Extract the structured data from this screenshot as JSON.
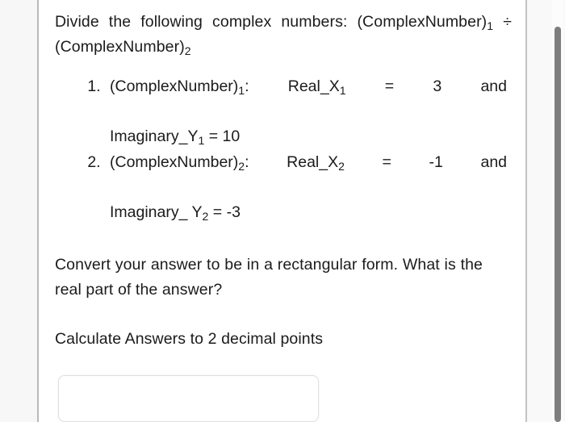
{
  "document": {
    "background_color": "#ffffff",
    "text_color": "#1b1b1b",
    "gutter_color": "#f7f7f7",
    "rule_color": "#b9b9b9"
  },
  "question": {
    "prompt_line_1": "Divide the following complex numbers:",
    "prompt_line_2_prefix": "(ComplexNumber)",
    "prompt_line_2_sub_1": "1",
    "prompt_operator": " ÷ ",
    "prompt_line_2_suffix": "(ComplexNumber)",
    "prompt_line_2_sub_2": "2",
    "items": [
      {
        "marker": "1.",
        "name": "(ComplexNumber)",
        "name_sub": "1",
        "colon": ":",
        "real_label": "Real_X",
        "real_sub": "1",
        "equals": "=",
        "real_value": "3",
        "conjunction": "and",
        "imag_label": "Imaginary_Y",
        "imag_sub": "1",
        "imag_equals": "=",
        "imag_value": "10"
      },
      {
        "marker": "2.",
        "name": "(ComplexNumber)",
        "name_sub": "2",
        "colon": ":",
        "real_label": "Real_X",
        "real_sub": "2",
        "equals": "=",
        "real_value": "-1",
        "conjunction": "and",
        "imag_label": "Imaginary_ Y",
        "imag_sub": "2",
        "imag_equals": "=",
        "imag_value": "-3"
      }
    ],
    "instruction_1": "Convert your answer to be in a rectangular form. What is the real part of the answer?",
    "instruction_2": "Calculate Answers to 2 decimal points"
  },
  "answer": {
    "value": "",
    "placeholder": ""
  },
  "scrollbar": {
    "thumb_color": "#7e7e7e",
    "track_color": "#fcfcfc"
  }
}
